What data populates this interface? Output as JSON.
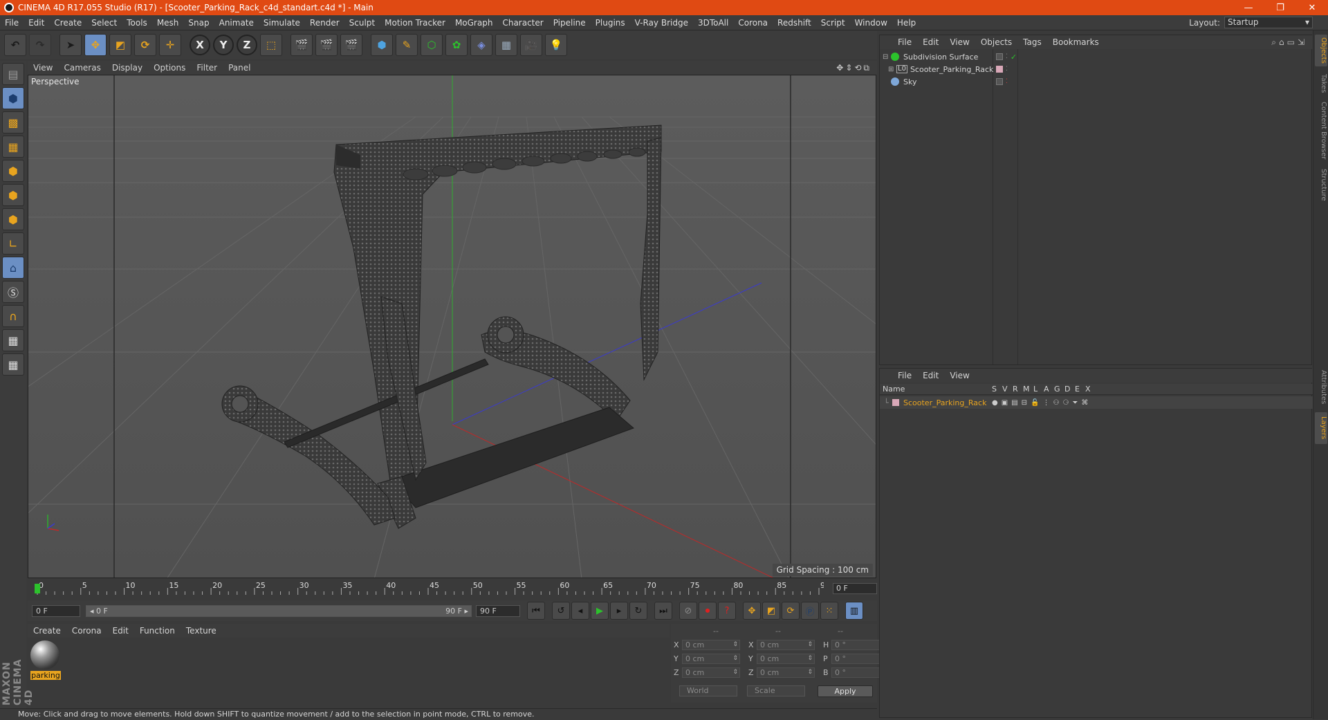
{
  "window": {
    "title": "CINEMA 4D R17.055 Studio (R17) - [Scooter_Parking_Rack_c4d_standart.c4d *] - Main",
    "controls": [
      "—",
      "❐",
      "✕"
    ]
  },
  "menu": {
    "items": [
      "File",
      "Edit",
      "Create",
      "Select",
      "Tools",
      "Mesh",
      "Snap",
      "Animate",
      "Simulate",
      "Render",
      "Sculpt",
      "Motion Tracker",
      "MoGraph",
      "Character",
      "Pipeline",
      "Plugins",
      "V-Ray Bridge",
      "3DToAll",
      "Corona",
      "Redshift",
      "Script",
      "Window",
      "Help"
    ],
    "layout_label": "Layout:",
    "layout_value": "Startup"
  },
  "toolbar": {
    "axis_x": "X",
    "axis_y": "Y",
    "axis_z": "Z"
  },
  "viewport": {
    "menu": [
      "View",
      "Cameras",
      "Display",
      "Options",
      "Filter",
      "Panel"
    ],
    "nav_icons": "✥⇕⟲⧉",
    "label": "Perspective",
    "grid_spacing": "Grid Spacing : 100 cm"
  },
  "timeline": {
    "ticks": [
      "0",
      "5",
      "10",
      "15",
      "20",
      "25",
      "30",
      "35",
      "40",
      "45",
      "50",
      "55",
      "60",
      "65",
      "70",
      "75",
      "80",
      "85",
      "90"
    ],
    "current_frame": "0 F"
  },
  "transport": {
    "start_field": "0 F",
    "range_start": "◂ 0 F",
    "range_end": "90 F ▸",
    "end_field": "90 F"
  },
  "material_panel": {
    "menu": [
      "Create",
      "Corona",
      "Edit",
      "Function",
      "Texture"
    ],
    "material_name": "parking"
  },
  "logo_text": "MAXON CINEMA 4D",
  "coordinates": {
    "headers": [
      "--",
      "--",
      "--"
    ],
    "rows": [
      {
        "a": "X",
        "av": "0 cm",
        "b": "X",
        "bv": "0 cm",
        "c": "H",
        "cv": "0 °"
      },
      {
        "a": "Y",
        "av": "0 cm",
        "b": "Y",
        "bv": "0 cm",
        "c": "P",
        "cv": "0 °"
      },
      {
        "a": "Z",
        "av": "0 cm",
        "b": "Z",
        "bv": "0 cm",
        "c": "B",
        "cv": "0 °"
      }
    ],
    "mode_world": "World",
    "mode_scale": "Scale",
    "apply": "Apply"
  },
  "status": "Move: Click and drag to move elements. Hold down SHIFT to quantize movement / add to the selection in point mode, CTRL to remove.",
  "object_manager": {
    "menu": [
      "File",
      "Edit",
      "View",
      "Objects",
      "Tags",
      "Bookmarks"
    ],
    "objects": [
      {
        "name": "Subdivision Surface",
        "tree": "⊟"
      },
      {
        "name": "Scooter_Parking_Rack",
        "tree": "⊞"
      },
      {
        "name": "Sky",
        "tree": ""
      }
    ]
  },
  "layer_manager": {
    "menu": [
      "File",
      "Edit",
      "View"
    ],
    "columns": [
      "Name",
      "S",
      "V",
      "R",
      "M",
      "L",
      "A",
      "G",
      "D",
      "E",
      "X"
    ],
    "layer_name": "Scooter_Parking_Rack"
  },
  "right_tabs": [
    "Objects",
    "Takes",
    "Content Browser",
    "Structure",
    "Attributes",
    "Layers"
  ],
  "colors": {
    "title_bar": "#e04a13",
    "accent_orange": "#e8a41f",
    "active_blue": "#6b8fc4"
  }
}
